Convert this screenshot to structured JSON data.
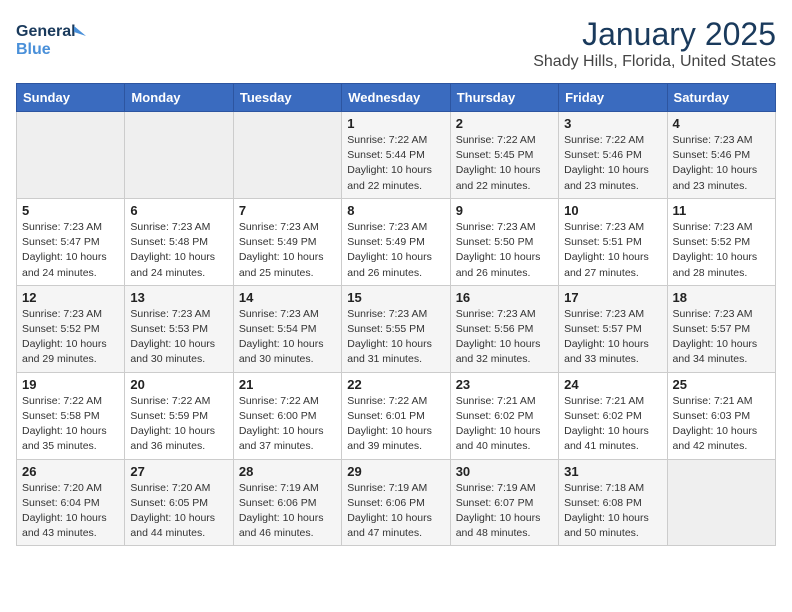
{
  "header": {
    "logo_line1": "General",
    "logo_line2": "Blue",
    "title": "January 2025",
    "subtitle": "Shady Hills, Florida, United States"
  },
  "weekdays": [
    "Sunday",
    "Monday",
    "Tuesday",
    "Wednesday",
    "Thursday",
    "Friday",
    "Saturday"
  ],
  "weeks": [
    [
      {
        "day": "",
        "info": ""
      },
      {
        "day": "",
        "info": ""
      },
      {
        "day": "",
        "info": ""
      },
      {
        "day": "1",
        "info": "Sunrise: 7:22 AM\nSunset: 5:44 PM\nDaylight: 10 hours\nand 22 minutes."
      },
      {
        "day": "2",
        "info": "Sunrise: 7:22 AM\nSunset: 5:45 PM\nDaylight: 10 hours\nand 22 minutes."
      },
      {
        "day": "3",
        "info": "Sunrise: 7:22 AM\nSunset: 5:46 PM\nDaylight: 10 hours\nand 23 minutes."
      },
      {
        "day": "4",
        "info": "Sunrise: 7:23 AM\nSunset: 5:46 PM\nDaylight: 10 hours\nand 23 minutes."
      }
    ],
    [
      {
        "day": "5",
        "info": "Sunrise: 7:23 AM\nSunset: 5:47 PM\nDaylight: 10 hours\nand 24 minutes."
      },
      {
        "day": "6",
        "info": "Sunrise: 7:23 AM\nSunset: 5:48 PM\nDaylight: 10 hours\nand 24 minutes."
      },
      {
        "day": "7",
        "info": "Sunrise: 7:23 AM\nSunset: 5:49 PM\nDaylight: 10 hours\nand 25 minutes."
      },
      {
        "day": "8",
        "info": "Sunrise: 7:23 AM\nSunset: 5:49 PM\nDaylight: 10 hours\nand 26 minutes."
      },
      {
        "day": "9",
        "info": "Sunrise: 7:23 AM\nSunset: 5:50 PM\nDaylight: 10 hours\nand 26 minutes."
      },
      {
        "day": "10",
        "info": "Sunrise: 7:23 AM\nSunset: 5:51 PM\nDaylight: 10 hours\nand 27 minutes."
      },
      {
        "day": "11",
        "info": "Sunrise: 7:23 AM\nSunset: 5:52 PM\nDaylight: 10 hours\nand 28 minutes."
      }
    ],
    [
      {
        "day": "12",
        "info": "Sunrise: 7:23 AM\nSunset: 5:52 PM\nDaylight: 10 hours\nand 29 minutes."
      },
      {
        "day": "13",
        "info": "Sunrise: 7:23 AM\nSunset: 5:53 PM\nDaylight: 10 hours\nand 30 minutes."
      },
      {
        "day": "14",
        "info": "Sunrise: 7:23 AM\nSunset: 5:54 PM\nDaylight: 10 hours\nand 30 minutes."
      },
      {
        "day": "15",
        "info": "Sunrise: 7:23 AM\nSunset: 5:55 PM\nDaylight: 10 hours\nand 31 minutes."
      },
      {
        "day": "16",
        "info": "Sunrise: 7:23 AM\nSunset: 5:56 PM\nDaylight: 10 hours\nand 32 minutes."
      },
      {
        "day": "17",
        "info": "Sunrise: 7:23 AM\nSunset: 5:57 PM\nDaylight: 10 hours\nand 33 minutes."
      },
      {
        "day": "18",
        "info": "Sunrise: 7:23 AM\nSunset: 5:57 PM\nDaylight: 10 hours\nand 34 minutes."
      }
    ],
    [
      {
        "day": "19",
        "info": "Sunrise: 7:22 AM\nSunset: 5:58 PM\nDaylight: 10 hours\nand 35 minutes."
      },
      {
        "day": "20",
        "info": "Sunrise: 7:22 AM\nSunset: 5:59 PM\nDaylight: 10 hours\nand 36 minutes."
      },
      {
        "day": "21",
        "info": "Sunrise: 7:22 AM\nSunset: 6:00 PM\nDaylight: 10 hours\nand 37 minutes."
      },
      {
        "day": "22",
        "info": "Sunrise: 7:22 AM\nSunset: 6:01 PM\nDaylight: 10 hours\nand 39 minutes."
      },
      {
        "day": "23",
        "info": "Sunrise: 7:21 AM\nSunset: 6:02 PM\nDaylight: 10 hours\nand 40 minutes."
      },
      {
        "day": "24",
        "info": "Sunrise: 7:21 AM\nSunset: 6:02 PM\nDaylight: 10 hours\nand 41 minutes."
      },
      {
        "day": "25",
        "info": "Sunrise: 7:21 AM\nSunset: 6:03 PM\nDaylight: 10 hours\nand 42 minutes."
      }
    ],
    [
      {
        "day": "26",
        "info": "Sunrise: 7:20 AM\nSunset: 6:04 PM\nDaylight: 10 hours\nand 43 minutes."
      },
      {
        "day": "27",
        "info": "Sunrise: 7:20 AM\nSunset: 6:05 PM\nDaylight: 10 hours\nand 44 minutes."
      },
      {
        "day": "28",
        "info": "Sunrise: 7:19 AM\nSunset: 6:06 PM\nDaylight: 10 hours\nand 46 minutes."
      },
      {
        "day": "29",
        "info": "Sunrise: 7:19 AM\nSunset: 6:06 PM\nDaylight: 10 hours\nand 47 minutes."
      },
      {
        "day": "30",
        "info": "Sunrise: 7:19 AM\nSunset: 6:07 PM\nDaylight: 10 hours\nand 48 minutes."
      },
      {
        "day": "31",
        "info": "Sunrise: 7:18 AM\nSunset: 6:08 PM\nDaylight: 10 hours\nand 50 minutes."
      },
      {
        "day": "",
        "info": ""
      }
    ]
  ]
}
